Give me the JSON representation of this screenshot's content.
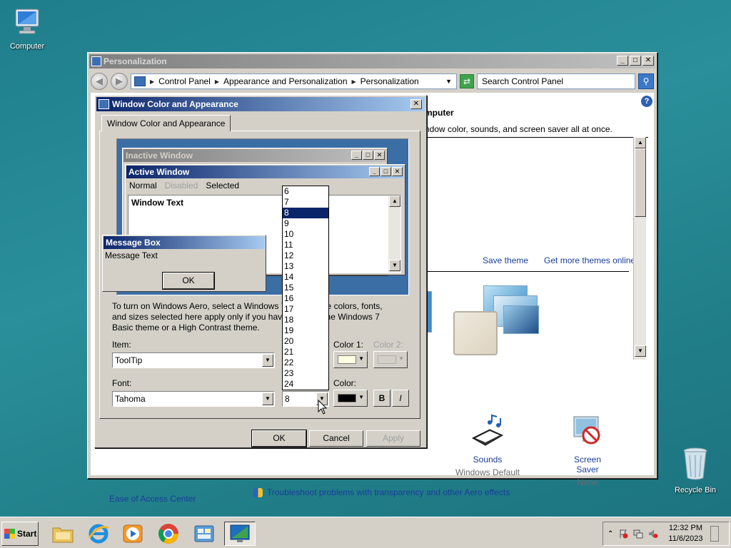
{
  "desktop": {
    "computer_label": "Computer",
    "recycle_label": "Recycle Bin"
  },
  "personalization": {
    "title": "Personalization",
    "breadcrumb": [
      "Control Panel",
      "Appearance and Personalization",
      "Personalization"
    ],
    "search_placeholder": "Search Control Panel",
    "heading_partial": "mputer",
    "desc_partial": "ndow color, sounds, and screen saver all at once.",
    "save_theme": "Save theme",
    "more_themes": "Get more themes online",
    "sounds_label": "Sounds",
    "sounds_value": "Windows Default",
    "screensaver_label": "Screen Saver",
    "screensaver_value": "None",
    "see_also": "Ease of Access Center",
    "troubleshoot": "Troubleshoot problems with transparency and other Aero effects"
  },
  "dialog": {
    "title": "Window Color and Appearance",
    "tab": "Window Color and Appearance",
    "preview": {
      "inactive_title": "Inactive Window",
      "active_title": "Active Window",
      "menu_normal": "Normal",
      "menu_disabled": "Disabled",
      "menu_selected": "Selected",
      "window_text": "Window Text",
      "msgbox_title": "Message Box",
      "msgbox_text": "Message Text",
      "msgbox_ok": "OK"
    },
    "info": "To turn on Windows Aero, select a Windows 7 theme. The colors, fonts, and sizes selected here apply only if you have selected the Windows 7 Basic theme or a High Contrast theme.",
    "item_label": "Item:",
    "item_value": "ToolTip",
    "size_label": "Size:",
    "color1_label": "Color 1:",
    "color2_label": "Color 2:",
    "font_label": "Font:",
    "font_value": "Tahoma",
    "font_size_value": "8",
    "color_label": "Color:",
    "bold": "B",
    "italic": "I",
    "ok": "OK",
    "cancel": "Cancel",
    "apply": "Apply",
    "size_options": [
      "6",
      "7",
      "8",
      "9",
      "10",
      "11",
      "12",
      "13",
      "14",
      "15",
      "16",
      "17",
      "18",
      "19",
      "20",
      "21",
      "22",
      "23",
      "24"
    ],
    "size_selected": "8",
    "color1_hex": "#ffffe1",
    "font_color_hex": "#000000"
  },
  "taskbar": {
    "start_label": "Start",
    "time": "12:32 PM",
    "date": "11/6/2023"
  }
}
